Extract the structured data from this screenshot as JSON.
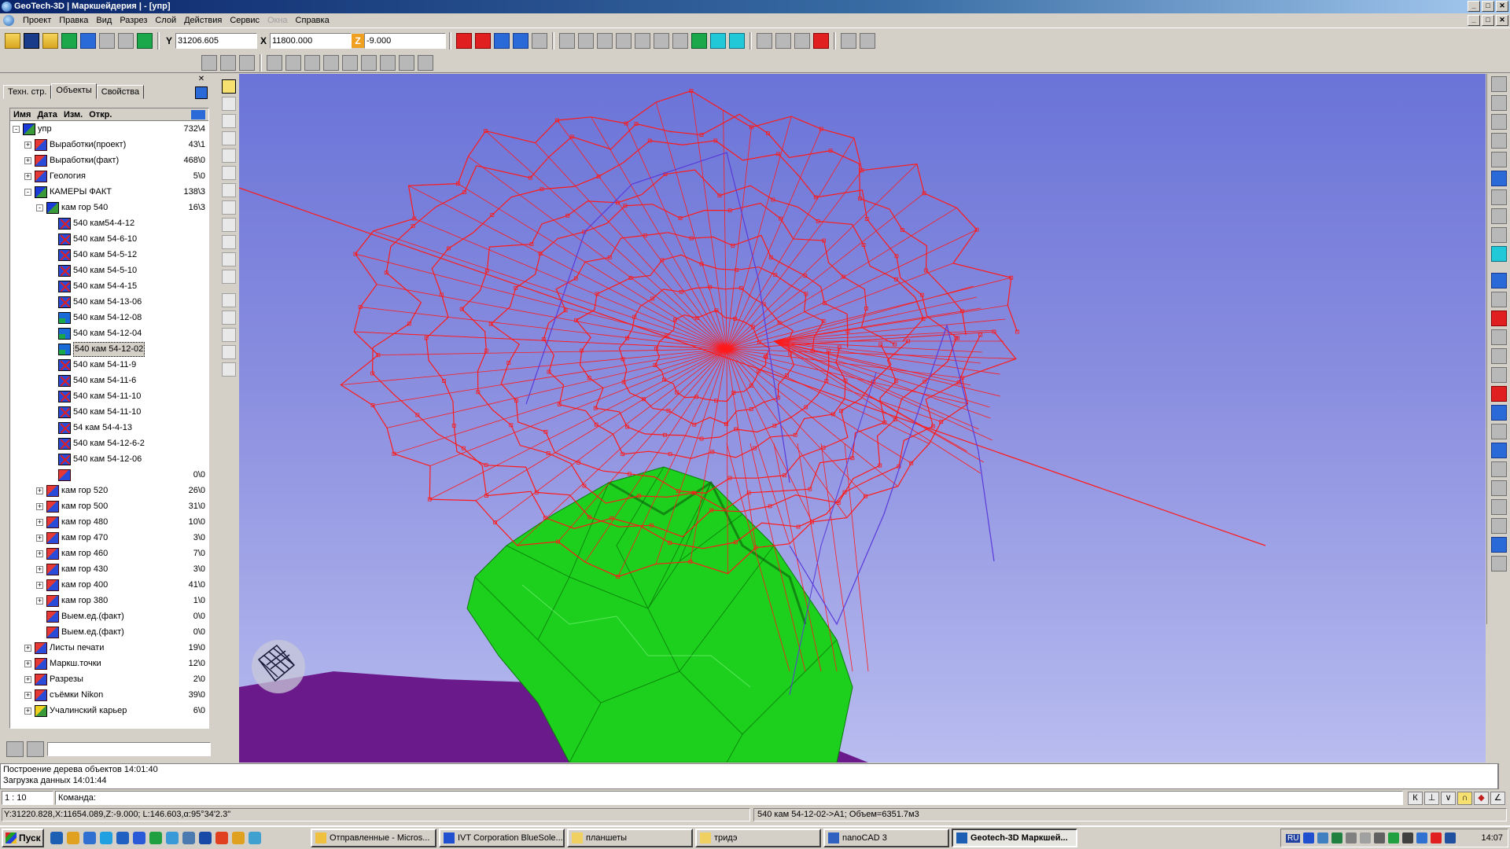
{
  "window": {
    "title": "GeoTech-3D | Маркшейдерия | - [упр]",
    "controls": [
      "_",
      "□",
      "✕"
    ],
    "mdi_controls": [
      "_",
      "□",
      "✕"
    ]
  },
  "menu": {
    "items": [
      "Проект",
      "Правка",
      "Вид",
      "Разрез",
      "Слой",
      "Действия",
      "Сервис",
      "Окна",
      "Справка"
    ],
    "disabled_item": "Окна"
  },
  "coords": {
    "y_label": "Y",
    "y_value": "31206.605",
    "x_label": "X",
    "x_value": "11800.000",
    "z_label": "Z",
    "z_value": "-9.000"
  },
  "left_panel": {
    "close": "✕",
    "tabs": [
      "Техн. стр.",
      "Объекты",
      "Свойства"
    ],
    "active_tab": "Объекты",
    "columns": [
      "Имя",
      "Дата",
      "Изм.",
      "Откр."
    ],
    "tree": [
      {
        "label": "упр",
        "count": "732\\4",
        "level": 0,
        "expander": "-",
        "icon": "layer"
      },
      {
        "label": "Выработки(проект)",
        "count": "43\\1",
        "level": 1,
        "expander": "+",
        "icon": "folder"
      },
      {
        "label": "Выработки(факт)",
        "count": "468\\0",
        "level": 1,
        "expander": "+",
        "icon": "folder"
      },
      {
        "label": "Геология",
        "count": "5\\0",
        "level": 1,
        "expander": "+",
        "icon": "folder"
      },
      {
        "label": "КАМЕРЫ ФАКТ",
        "count": "138\\3",
        "level": 1,
        "expander": "-",
        "icon": "layer"
      },
      {
        "label": "кам гор 540",
        "count": "16\\3",
        "level": 2,
        "expander": "-",
        "icon": "layer"
      },
      {
        "label": "540 кам54-4-12",
        "count": "",
        "level": 3,
        "icon": "cross"
      },
      {
        "label": "540 кам 54-6-10",
        "count": "",
        "level": 3,
        "icon": "cross"
      },
      {
        "label": "540 кам 54-5-12",
        "count": "",
        "level": 3,
        "icon": "cross"
      },
      {
        "label": "540 кам 54-5-10",
        "count": "",
        "level": 3,
        "icon": "cross"
      },
      {
        "label": "540 кам 54-4-15",
        "count": "",
        "level": 3,
        "icon": "cross"
      },
      {
        "label": "540 кам 54-13-06",
        "count": "",
        "level": 3,
        "icon": "cross"
      },
      {
        "label": "540 кам 54-12-08",
        "count": "",
        "level": 3,
        "icon": "solid"
      },
      {
        "label": "540 кам 54-12-04",
        "count": "",
        "level": 3,
        "icon": "solid"
      },
      {
        "label": "540 кам 54-12-02",
        "count": "",
        "level": 3,
        "icon": "solid",
        "selected": true
      },
      {
        "label": "540 кам 54-11-9",
        "count": "",
        "level": 3,
        "icon": "cross"
      },
      {
        "label": "540 кам 54-11-6",
        "count": "",
        "level": 3,
        "icon": "cross"
      },
      {
        "label": "540 кам 54-11-10",
        "count": "",
        "level": 3,
        "icon": "cross"
      },
      {
        "label": "540 кам 54-11-10",
        "count": "",
        "level": 3,
        "icon": "cross"
      },
      {
        "label": "54 кам 54-4-13",
        "count": "",
        "level": 3,
        "icon": "cross"
      },
      {
        "label": "540 кам 54-12-6-2",
        "count": "",
        "level": 3,
        "icon": "cross"
      },
      {
        "label": "540 кам 54-12-06",
        "count": "",
        "level": 3,
        "icon": "cross"
      },
      {
        "label": "",
        "count": "0\\0",
        "level": 3,
        "icon": "folder"
      },
      {
        "label": "кам гор 520",
        "count": "26\\0",
        "level": 2,
        "expander": "+",
        "icon": "folder"
      },
      {
        "label": "кам гор 500",
        "count": "31\\0",
        "level": 2,
        "expander": "+",
        "icon": "folder"
      },
      {
        "label": "кам гор 480",
        "count": "10\\0",
        "level": 2,
        "expander": "+",
        "icon": "folder"
      },
      {
        "label": "кам гор 470",
        "count": "3\\0",
        "level": 2,
        "expander": "+",
        "icon": "folder"
      },
      {
        "label": "кам гор 460",
        "count": "7\\0",
        "level": 2,
        "expander": "+",
        "icon": "folder"
      },
      {
        "label": "кам гор 430",
        "count": "3\\0",
        "level": 2,
        "expander": "+",
        "icon": "folder"
      },
      {
        "label": "кам гор 400",
        "count": "41\\0",
        "level": 2,
        "expander": "+",
        "icon": "folder"
      },
      {
        "label": "кам гор 380",
        "count": "1\\0",
        "level": 2,
        "expander": "+",
        "icon": "folder"
      },
      {
        "label": "Выем.ед.(факт)",
        "count": "0\\0",
        "level": 2,
        "icon": "folder"
      },
      {
        "label": "Выем.ед.(факт)",
        "count": "0\\0",
        "level": 2,
        "icon": "folder"
      },
      {
        "label": "Листы печати",
        "count": "19\\0",
        "level": 1,
        "expander": "+",
        "icon": "folder"
      },
      {
        "label": "Маркш.точки",
        "count": "12\\0",
        "level": 1,
        "expander": "+",
        "icon": "folder"
      },
      {
        "label": "Разрезы",
        "count": "2\\0",
        "level": 1,
        "expander": "+",
        "icon": "folder"
      },
      {
        "label": "съёмки Nikon",
        "count": "39\\0",
        "level": 1,
        "expander": "+",
        "icon": "folder"
      },
      {
        "label": "Учалинский карьер",
        "count": "6\\0",
        "level": 1,
        "expander": "+",
        "icon": "quarry"
      }
    ]
  },
  "log": {
    "lines": [
      "Построение дерева объектов 14:01:40",
      "Загрузка данных 14:01:44"
    ]
  },
  "command": {
    "scale": "1 : 10",
    "prompt": "Команда:",
    "tools": [
      "К",
      "⊥",
      "∨",
      "∩",
      "◆",
      "∠"
    ]
  },
  "status": {
    "cursor": "Y:31220.828,X:11654.089,Z:-9.000; L:146.603,α:95°34'2.3\"",
    "object": "540 кам 54-12-02->A1; Объем=6351.7м3"
  },
  "taskbar": {
    "start": "Пуск",
    "tasks": [
      {
        "label": "Отправленные - Micros...",
        "active": false,
        "color": "#f0c040"
      },
      {
        "label": "IVT Corporation BlueSole...",
        "active": false,
        "color": "#2050d0"
      },
      {
        "label": "планшеты",
        "active": false,
        "color": "#f0d060"
      },
      {
        "label": "тридэ",
        "active": false,
        "color": "#f0d060"
      },
      {
        "label": "nanoCAD 3",
        "active": false,
        "color": "#3060c0"
      },
      {
        "label": "Geotech-3D Маркшей...",
        "active": true,
        "color": "#1c5fb3"
      }
    ],
    "clock": "14:07",
    "lang": "RU"
  },
  "colors": {
    "viewport_top": "#6a74d8",
    "viewport_bottom": "#b8bcef",
    "wireframe": "#ff1a1a",
    "chamber_blue": "#5a3ad8",
    "orebody": "#1ed01e",
    "ground": "#6a1a8a"
  }
}
